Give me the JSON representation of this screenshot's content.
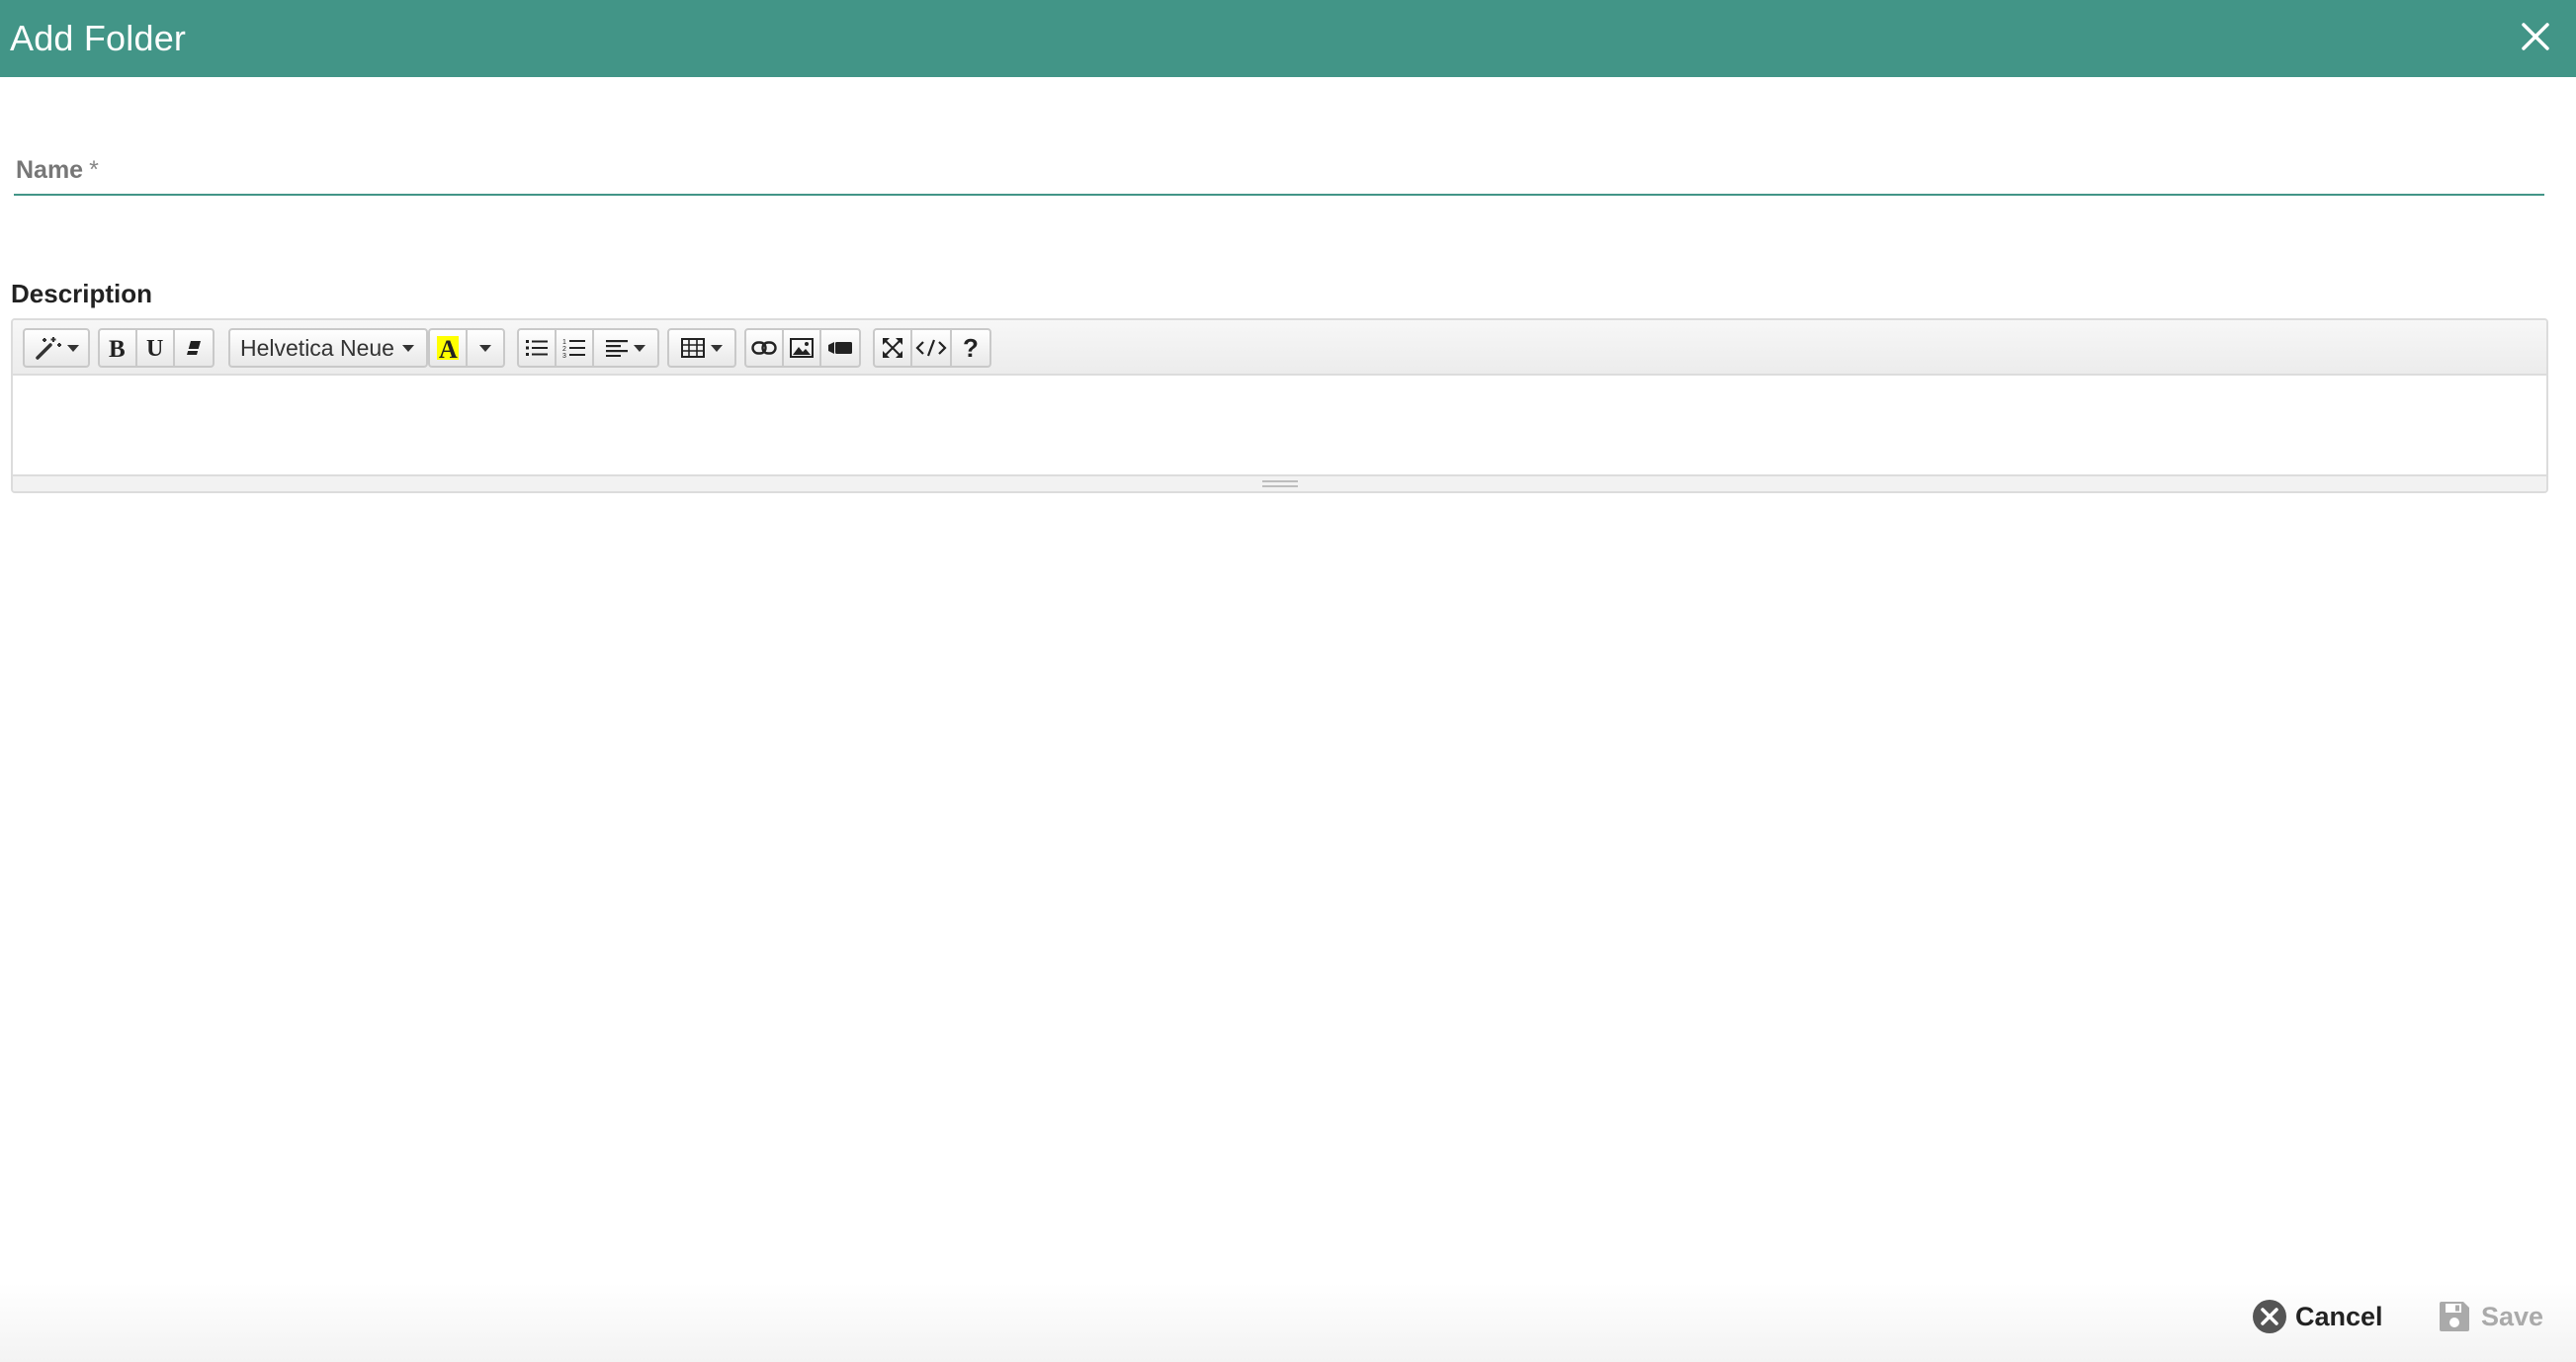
{
  "dialog": {
    "title": "Add Folder",
    "close_icon": "close-icon"
  },
  "name_field": {
    "label": "Name",
    "required_marker": "*",
    "value": ""
  },
  "description": {
    "label": "Description",
    "toolbar": {
      "style_icon": "magic-wand-icon",
      "bold_icon": "bold-icon",
      "underline_icon": "underline-icon",
      "clear_format_icon": "eraser-icon",
      "font_name": "Helvetica Neue",
      "color_icon": "text-color-icon",
      "unordered_list_icon": "bullet-list-icon",
      "ordered_list_icon": "numbered-list-icon",
      "align_icon": "align-left-icon",
      "table_icon": "table-icon",
      "link_icon": "link-icon",
      "image_icon": "image-icon",
      "video_icon": "video-icon",
      "fullscreen_icon": "fullscreen-icon",
      "code_icon": "code-view-icon",
      "help_icon": "help-icon"
    },
    "content": ""
  },
  "footer": {
    "cancel_label": "Cancel",
    "save_label": "Save"
  },
  "colors": {
    "header": "#429587",
    "highlight": "#ffff00",
    "save_disabled": "#aaaaaa"
  }
}
